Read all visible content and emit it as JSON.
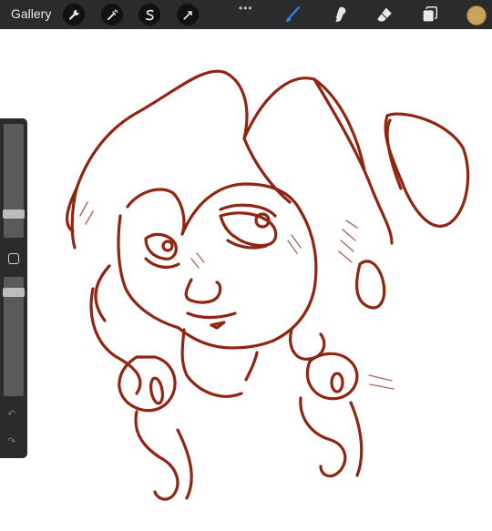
{
  "toolbar": {
    "gallery_label": "Gallery",
    "left_tools": [
      "wrench-icon",
      "magic-wand-icon",
      "selection-icon",
      "transform-arrow-icon"
    ],
    "right_tools": [
      "brush-icon",
      "smudge-icon",
      "eraser-icon",
      "layers-icon"
    ],
    "active_tool": "brush",
    "active_color": "#c9a35b",
    "accent": "#2f7ff0"
  },
  "sidebar": {
    "brush_size": 0.78,
    "opacity": 0.18
  },
  "canvas": {
    "stroke_color": "#8f2512"
  }
}
